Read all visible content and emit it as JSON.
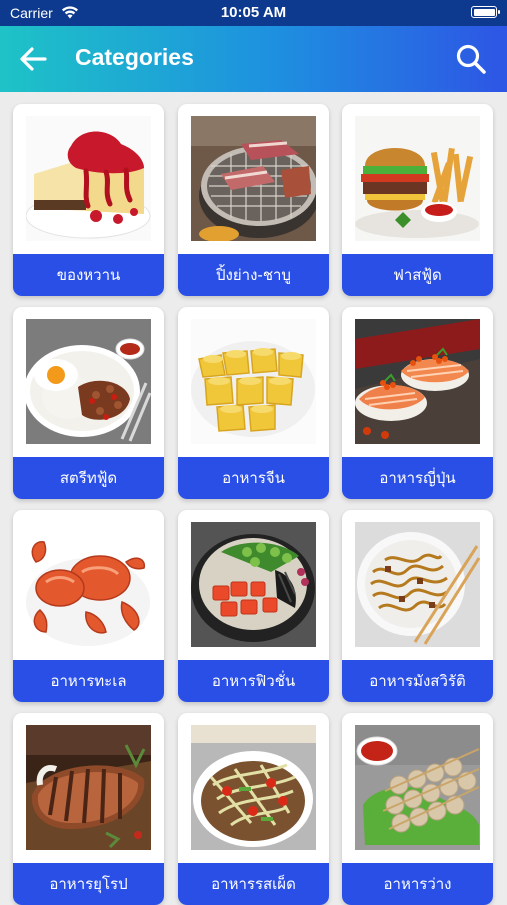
{
  "status_bar": {
    "carrier": "Carrier",
    "time": "10:05 AM"
  },
  "header": {
    "title": "Categories"
  },
  "categories": [
    {
      "label": "ของหวาน",
      "icon": "cheesecake-photo"
    },
    {
      "label": "ปิ้งย่าง-ชาบู",
      "icon": "grill-photo"
    },
    {
      "label": "ฟาสฟู้ด",
      "icon": "burger-photo"
    },
    {
      "label": "สตรีทฟู้ด",
      "icon": "basil-rice-photo"
    },
    {
      "label": "อาหารจีน",
      "icon": "dimsum-photo"
    },
    {
      "label": "อาหารญี่ปุ่น",
      "icon": "sushi-photo"
    },
    {
      "label": "อาหารทะเล",
      "icon": "crab-photo"
    },
    {
      "label": "อาหารฟิวชั่น",
      "icon": "poke-bowl-photo"
    },
    {
      "label": "อาหารมังสวิรัติ",
      "icon": "noodles-photo"
    },
    {
      "label": "อาหารยุโรป",
      "icon": "steak-photo"
    },
    {
      "label": "อาหารรสเผ็ด",
      "icon": "papaya-salad-photo"
    },
    {
      "label": "อาหารว่าง",
      "icon": "meatball-skewers-photo"
    }
  ]
}
